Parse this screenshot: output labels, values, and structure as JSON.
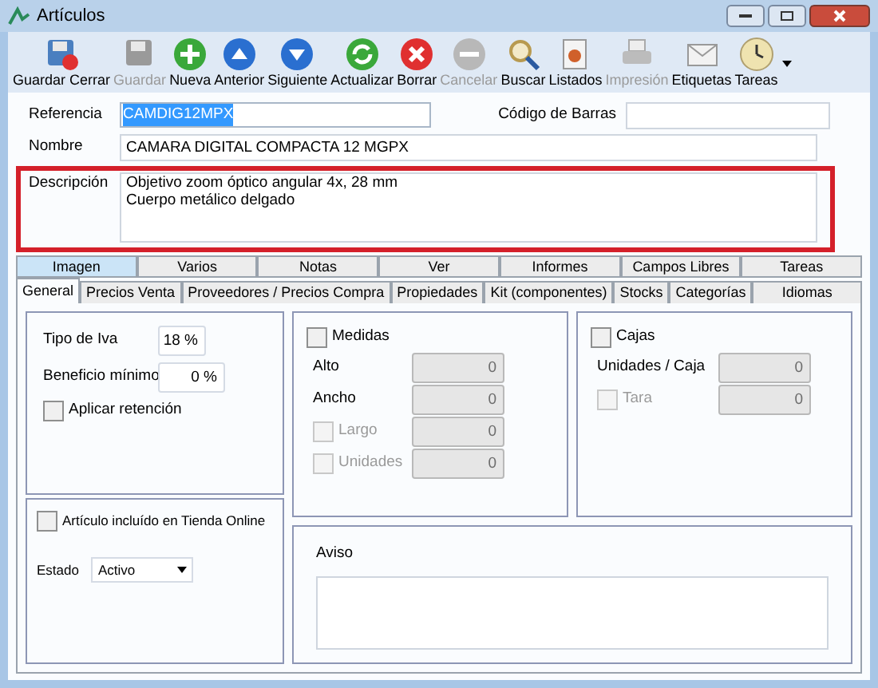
{
  "window": {
    "title": "Artículos"
  },
  "toolbar": [
    {
      "label": "Guardar Cerrar",
      "kind": "save-close",
      "disabled": false
    },
    {
      "label": "Guardar",
      "kind": "save",
      "disabled": true
    },
    {
      "label": "Nueva",
      "kind": "add",
      "disabled": false
    },
    {
      "label": "Anterior",
      "kind": "up",
      "disabled": false
    },
    {
      "label": "Siguiente",
      "kind": "down",
      "disabled": false
    },
    {
      "label": "Actualizar",
      "kind": "refresh",
      "disabled": false
    },
    {
      "label": "Borrar",
      "kind": "delete",
      "disabled": false
    },
    {
      "label": "Cancelar",
      "kind": "cancel",
      "disabled": true
    },
    {
      "label": "Buscar",
      "kind": "search",
      "disabled": false
    },
    {
      "label": "Listados",
      "kind": "report",
      "disabled": false
    },
    {
      "label": "Impresión",
      "kind": "print",
      "disabled": true
    },
    {
      "label": "Etiquetas",
      "kind": "mail",
      "disabled": false
    },
    {
      "label": "Tareas",
      "kind": "clock",
      "disabled": false
    }
  ],
  "form": {
    "referencia": {
      "label": "Referencia",
      "value": "CAMDIG12MPX",
      "text_selected": true
    },
    "codigo_barras": {
      "label": "Código de Barras"
    },
    "nombre": {
      "label": "Nombre",
      "value": "CAMARA DIGITAL COMPACTA 12 MGPX"
    },
    "descripcion": {
      "label": "Descripción",
      "value": "Objetivo zoom óptico angular 4x, 28 mm\nCuerpo metálico delgado",
      "highlighted": true
    }
  },
  "tabs_back": [
    {
      "label": "Imagen",
      "hovered": true
    },
    {
      "label": "Varios",
      "hovered": false
    },
    {
      "label": "Notas",
      "hovered": false
    },
    {
      "label": "Ver",
      "hovered": false
    },
    {
      "label": "Informes",
      "hovered": false
    },
    {
      "label": "Campos Libres",
      "hovered": false
    },
    {
      "label": "Tareas",
      "hovered": false
    }
  ],
  "tabs": [
    {
      "label": "General",
      "selected": true
    },
    {
      "label": "Precios Venta",
      "selected": false
    },
    {
      "label": "Proveedores / Precios Compra",
      "selected": false
    },
    {
      "label": "Propiedades",
      "selected": false
    },
    {
      "label": "Kit (componentes)",
      "selected": false
    },
    {
      "label": "Stocks",
      "selected": false
    },
    {
      "label": "Categorías",
      "selected": false
    },
    {
      "label": "Idiomas",
      "selected": false
    }
  ],
  "general": {
    "tipo_iva": {
      "label": "Tipo de Iva",
      "value": "18 %"
    },
    "beneficio": {
      "label": "Beneficio mínimo",
      "value": "0 %"
    },
    "aplicar_retencion": {
      "label": "Aplicar retención",
      "checked": false
    },
    "medidas": {
      "label": "Medidas",
      "checked": false,
      "fields": [
        {
          "kind": "plain",
          "label": "Alto",
          "value": "0"
        },
        {
          "kind": "plain",
          "label": "Ancho",
          "value": "0"
        },
        {
          "kind": "checkbox",
          "label": "Largo",
          "value": "0",
          "checked": false,
          "disabled": true
        },
        {
          "kind": "checkbox",
          "label": "Unidades",
          "value": "0",
          "checked": false,
          "disabled": true
        }
      ]
    },
    "cajas": {
      "label": "Cajas",
      "checked": false,
      "fields": [
        {
          "kind": "plain",
          "label": "Unidades / Caja",
          "value": "0"
        },
        {
          "kind": "checkbox",
          "label": "Tara",
          "value": "0",
          "checked": false,
          "disabled": true
        }
      ]
    },
    "tienda_online": {
      "label": "Artículo incluído en Tienda Online",
      "checked": false
    },
    "estado": {
      "label": "Estado",
      "value": "Activo"
    },
    "aviso": {
      "label": "Aviso"
    }
  }
}
